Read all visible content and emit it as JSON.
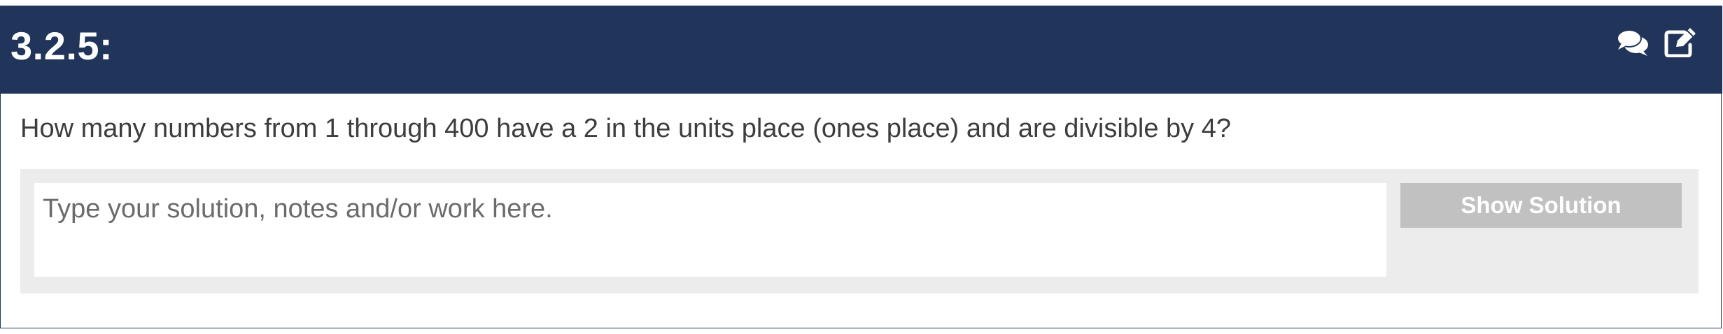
{
  "exercise": {
    "number": "3.2.5:",
    "question": "How many numbers from 1 through 400 have a 2 in the units place (ones place) and are divisible by 4?"
  },
  "header_icons": {
    "comment": "comments-icon",
    "edit": "edit-icon"
  },
  "answer": {
    "value": "",
    "placeholder": "Type your solution, notes and/or work here.",
    "show_solution_label": "Show Solution"
  },
  "colors": {
    "header_background": "#21355a",
    "panel_background": "#ececec",
    "button_background": "#c1c1c1",
    "text": "#3d3d3d"
  }
}
